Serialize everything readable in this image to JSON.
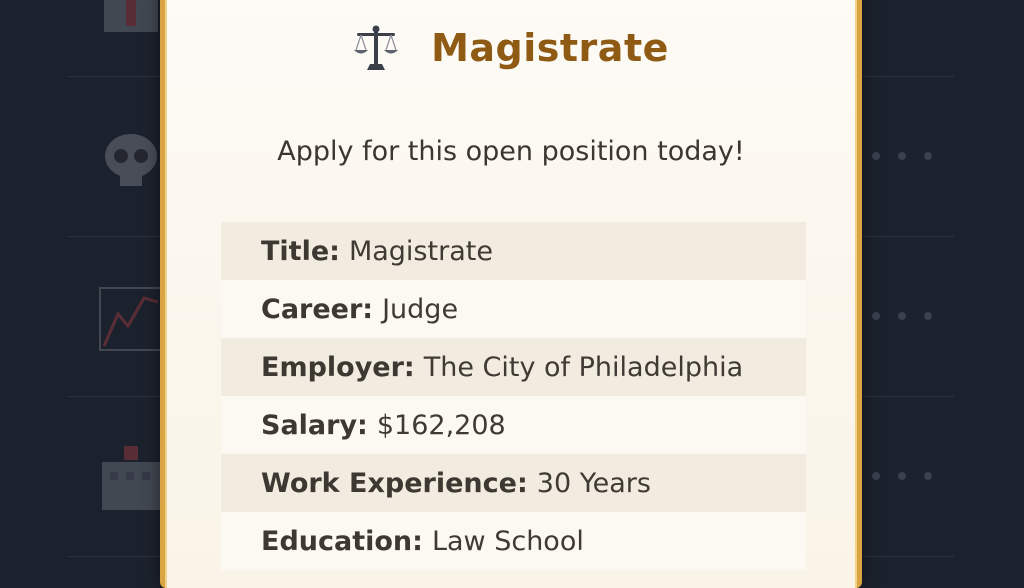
{
  "job": {
    "icon": "balance-scale-icon",
    "title": "Magistrate",
    "tagline": "Apply for this open position today!"
  },
  "details": [
    {
      "label": "Title:",
      "value": "Magistrate"
    },
    {
      "label": "Career:",
      "value": "Judge"
    },
    {
      "label": "Employer:",
      "value": "The City of Philadelphia"
    },
    {
      "label": "Salary:",
      "value": "$162,208"
    },
    {
      "label": "Work Experience:",
      "value": "30 Years"
    },
    {
      "label": "Education:",
      "value": "Law School"
    }
  ],
  "background_list": {
    "item_icons": [
      "hospital-icon",
      "skull-icon",
      "stock-chart-icon",
      "hospital-building-icon"
    ],
    "more_icon": "more-dots-icon"
  },
  "colors": {
    "backdrop": "#1c222d",
    "card_border": "#d9a441",
    "title": "#8e5a14",
    "row_shade": "#f2ebdf"
  }
}
